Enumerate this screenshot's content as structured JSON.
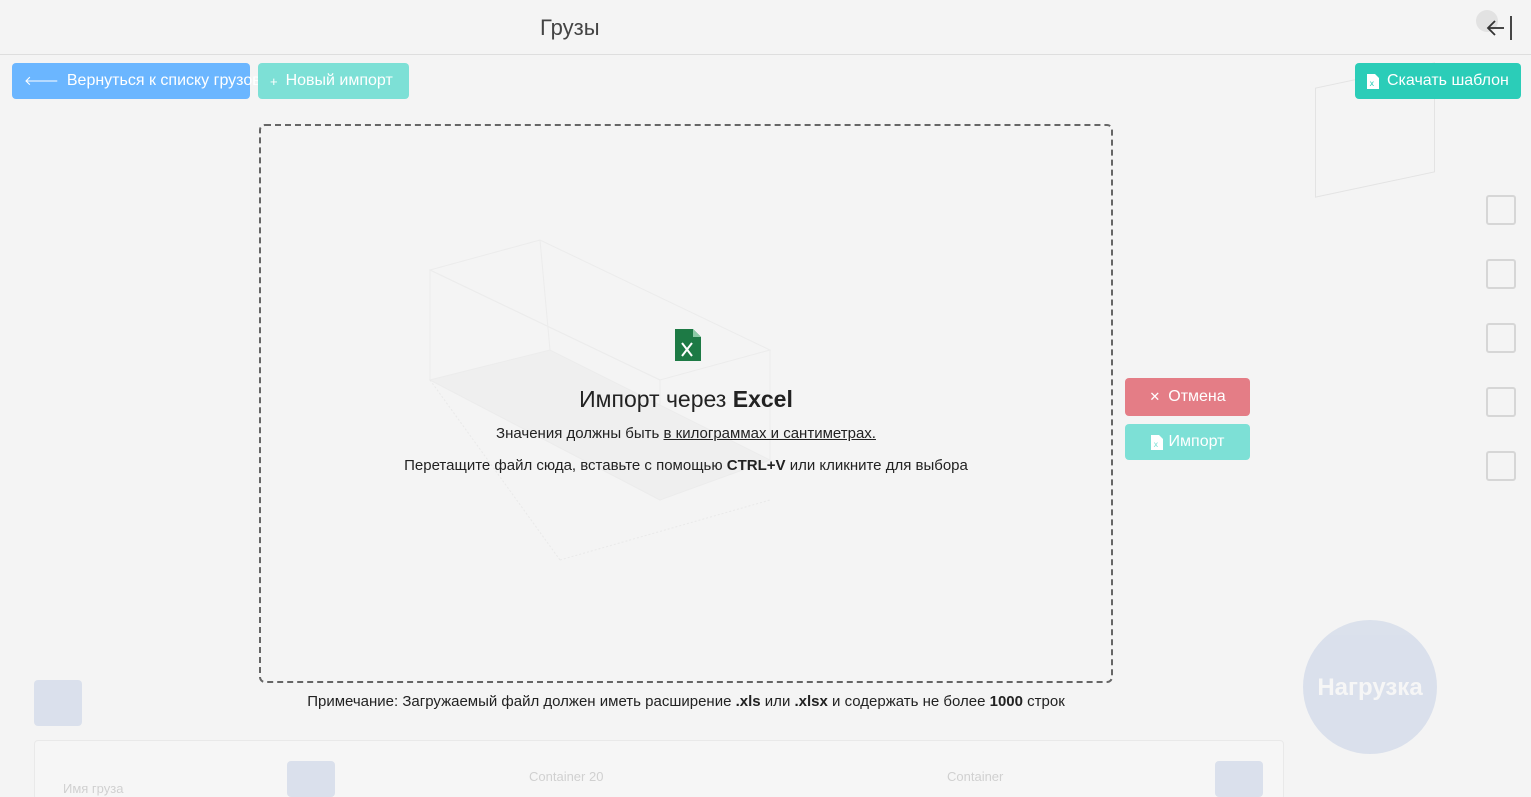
{
  "header": {
    "title": "Грузы"
  },
  "toolbar": {
    "back_label": "Вернуться к списку грузов",
    "new_import_label": "Новый импорт",
    "download_template_label": "Скачать шаблон"
  },
  "dropzone": {
    "title_prefix": "Импорт через ",
    "title_bold": "Excel",
    "units_prefix": "Значения должны быть ",
    "units_link": "в килограммах и сантиметрах.",
    "hint_prefix": "Перетащите файл сюда, вставьте с помощью ",
    "hint_shortcut": "CTRL+V",
    "hint_suffix": " или кликните для выбора"
  },
  "note": {
    "prefix": "Примечание: Загружаемый файл должен иметь расширение ",
    "ext1": ".xls",
    "mid": " или ",
    "ext2": ".xlsx",
    "mid2": " и содержать не более ",
    "limit": "1000",
    "suffix": " строк"
  },
  "actions": {
    "cancel_label": "Отмена",
    "import_label": "Импорт"
  },
  "background": {
    "circle_label": "Нагрузка",
    "table_col1": "Имя груза",
    "table_col2": "Container 20",
    "table_col3": "Container"
  },
  "colors": {
    "back_button": "#6bb6ff",
    "teal": "#2bcdb8",
    "teal_disabled": "#7de0d6",
    "cancel": "#e47d86",
    "excel_green": "#1d7a45"
  }
}
